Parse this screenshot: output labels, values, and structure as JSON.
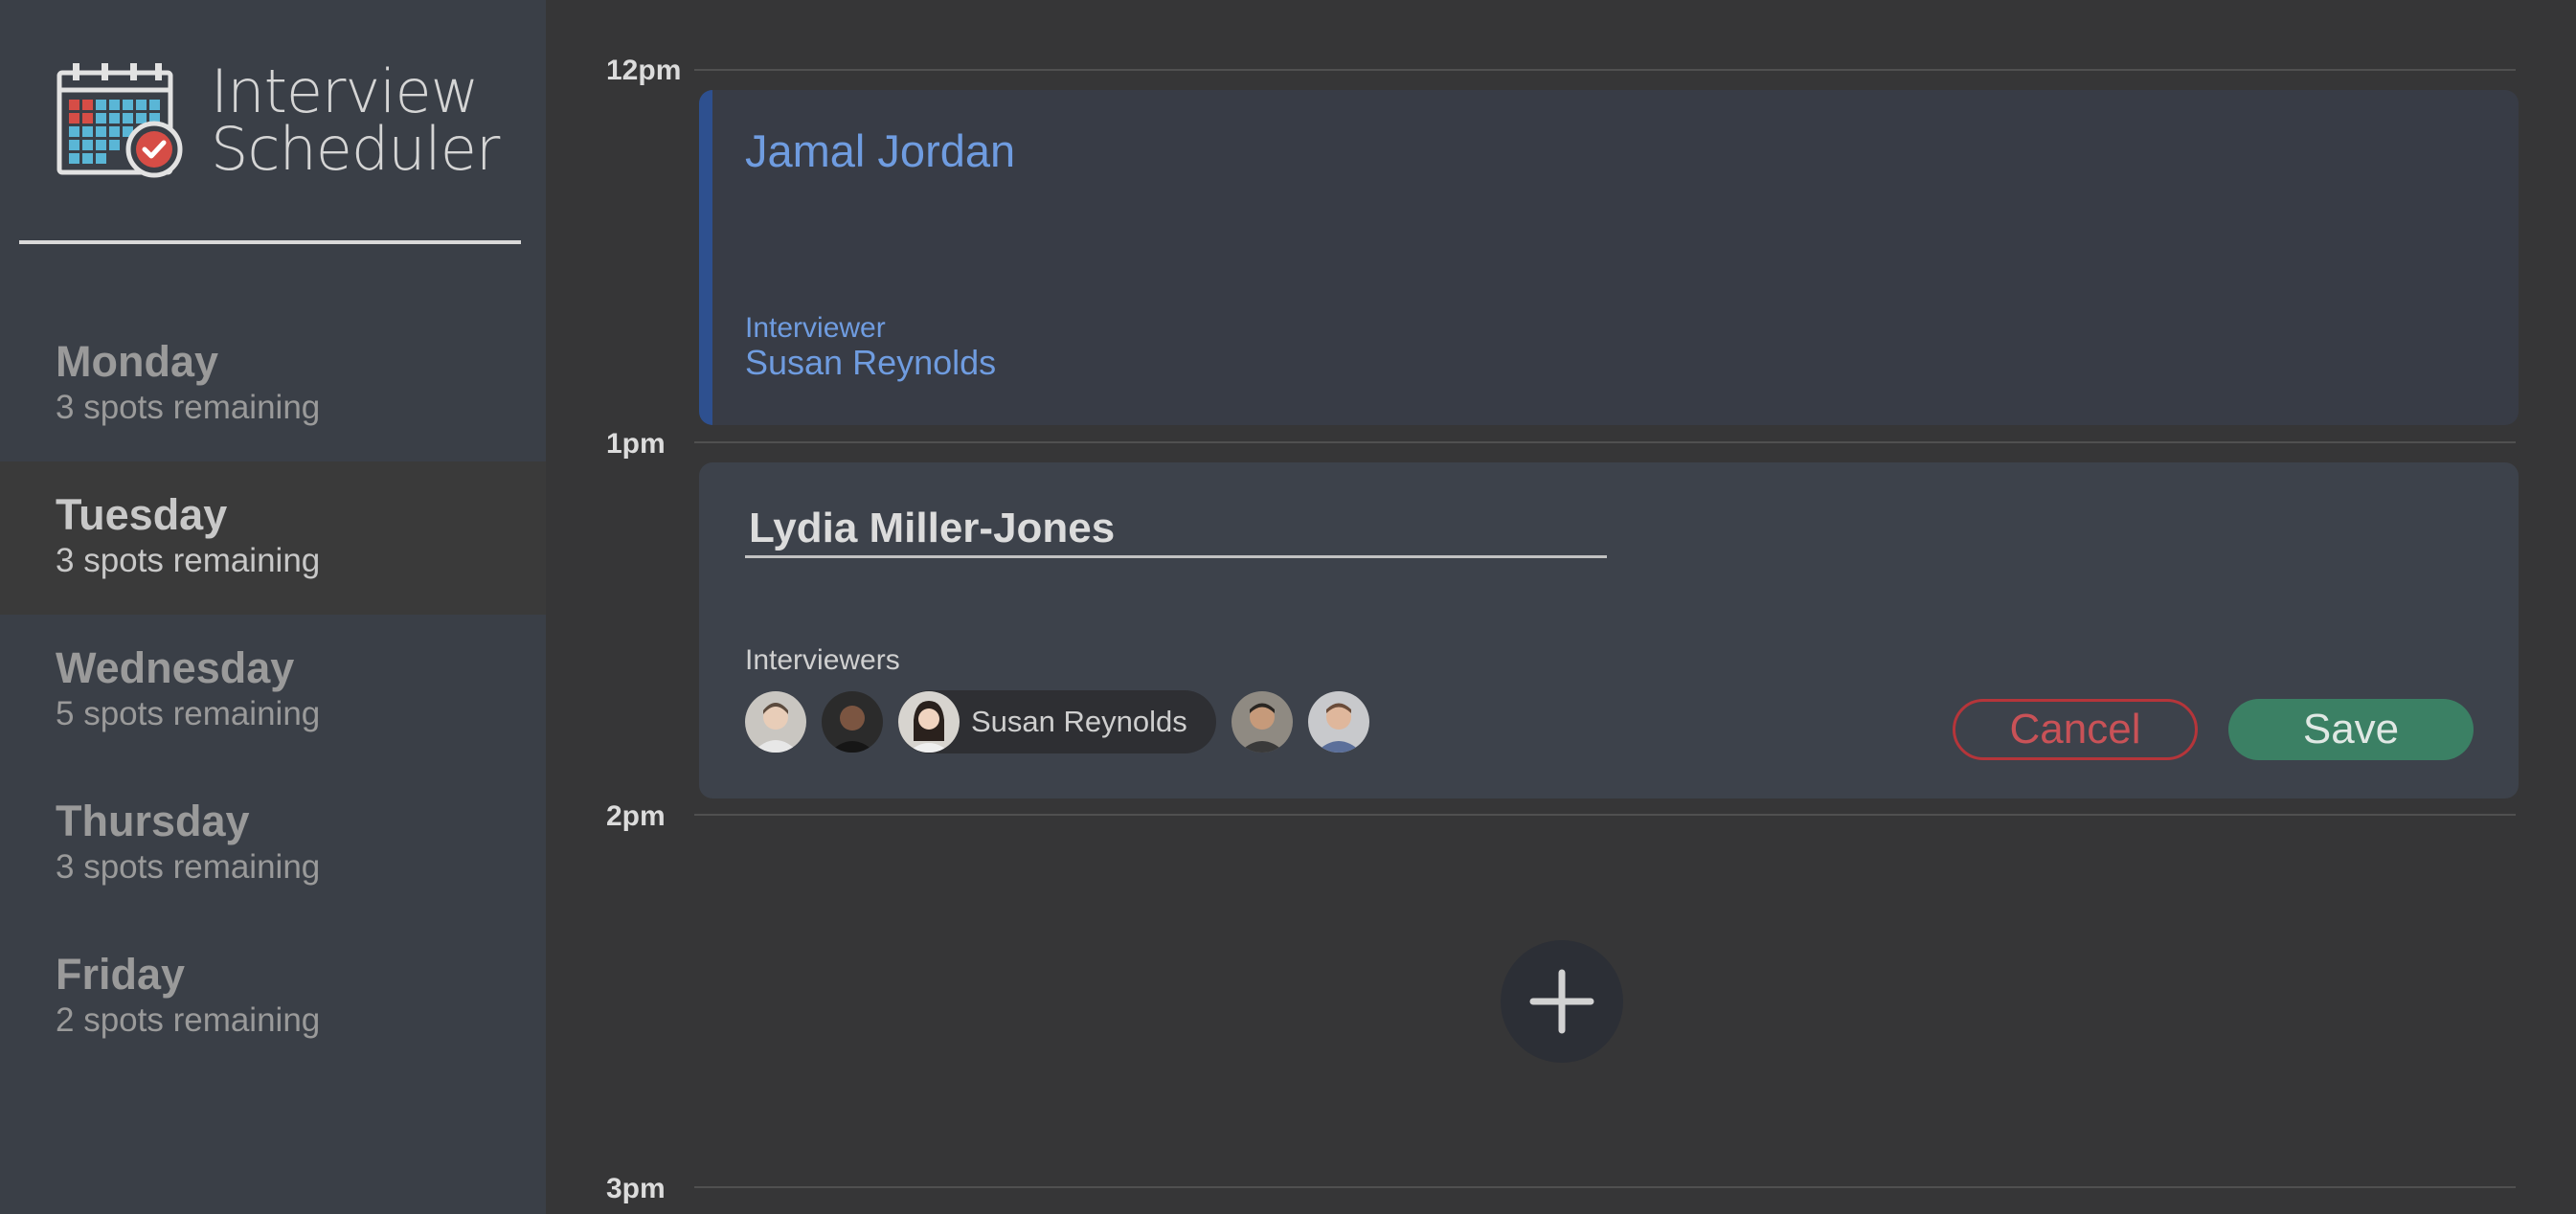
{
  "app": {
    "title_line1": "Interview",
    "title_line2": "Scheduler",
    "logo_icon": "calendar-check-icon"
  },
  "days": [
    {
      "name": "Monday",
      "spots": "3 spots remaining",
      "selected": false
    },
    {
      "name": "Tuesday",
      "spots": "3 spots remaining",
      "selected": true
    },
    {
      "name": "Wednesday",
      "spots": "5 spots remaining",
      "selected": false
    },
    {
      "name": "Thursday",
      "spots": "3 spots remaining",
      "selected": false
    },
    {
      "name": "Friday",
      "spots": "2 spots remaining",
      "selected": false
    }
  ],
  "times": [
    "12pm",
    "1pm",
    "2pm",
    "3pm"
  ],
  "appointment_show": {
    "student": "Jamal Jordan",
    "interviewer_label": "Interviewer",
    "interviewer": "Susan Reynolds"
  },
  "appointment_form": {
    "student_value": "Lydia Miller-Jones",
    "interviewers_label": "Interviewers",
    "selected_interviewer": "Susan Reynolds",
    "cancel_label": "Cancel",
    "save_label": "Save"
  },
  "add_button_icon": "plus-icon",
  "colors": {
    "accent_blue": "#6f9ce0",
    "cancel_red": "#c95257",
    "save_green": "#3b8064",
    "sidebar_bg": "#3a3f47",
    "main_bg": "#363637"
  }
}
